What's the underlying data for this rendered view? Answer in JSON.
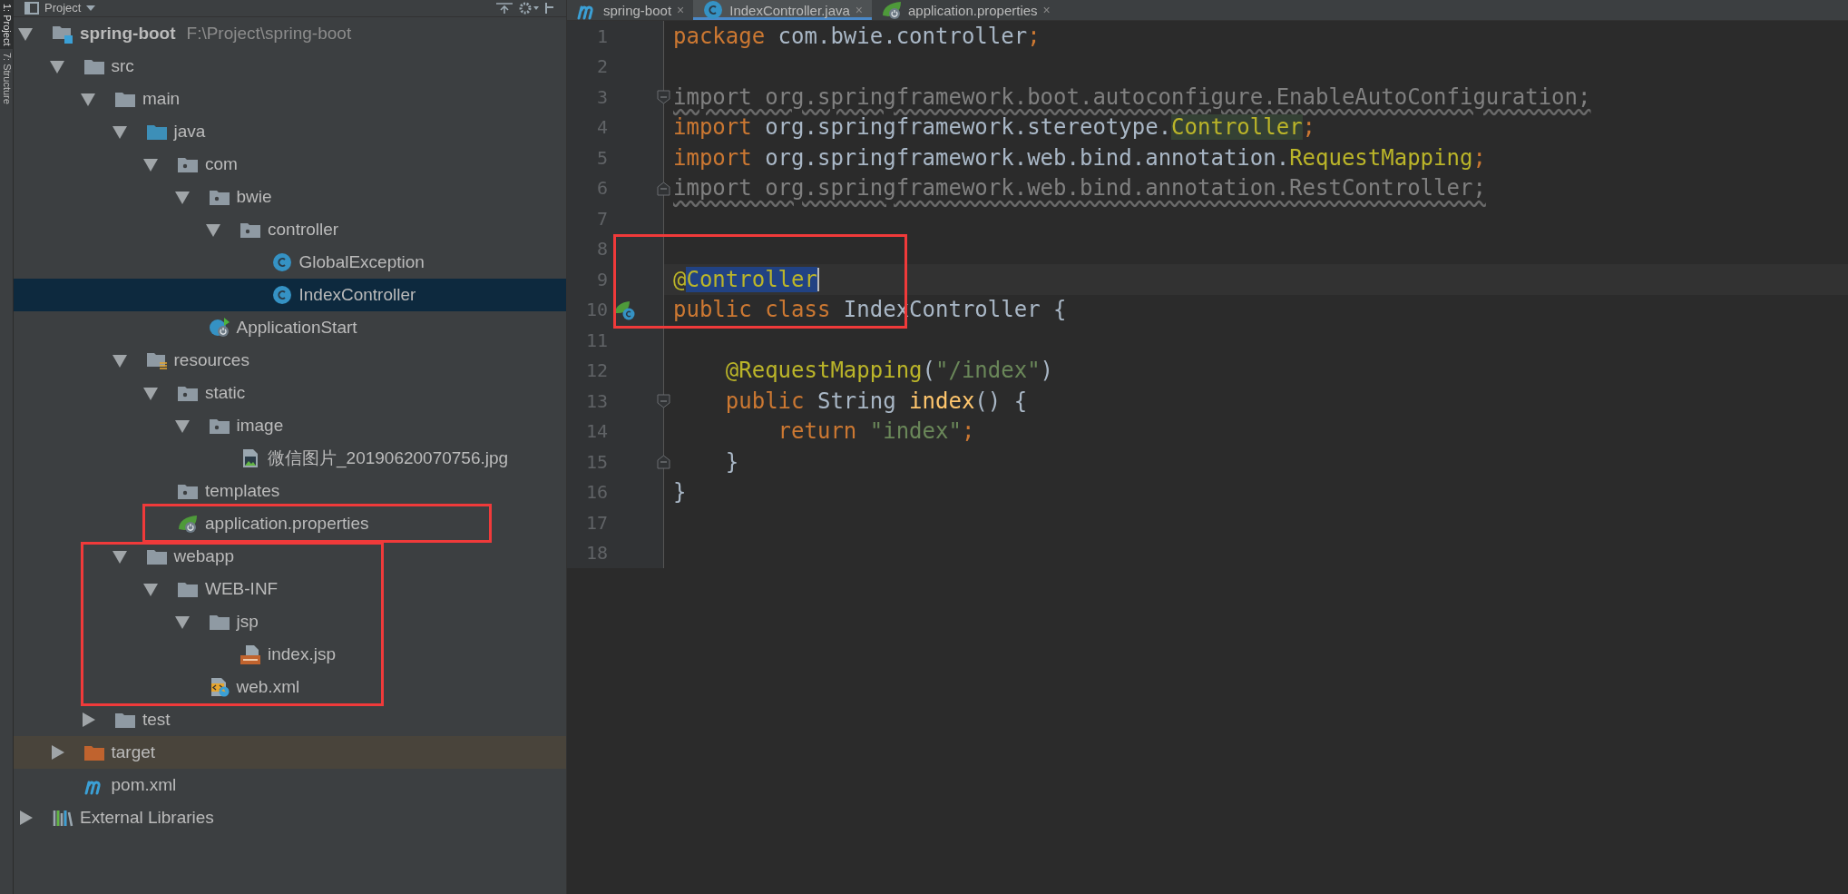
{
  "tool_strip": {
    "tabs": [
      {
        "label": "1: Project",
        "selected": true
      },
      {
        "label": "7: Structure",
        "selected": false
      }
    ]
  },
  "project_panel": {
    "title": "Project",
    "tree": [
      {
        "label": "spring-boot",
        "hint": "F:\\Project\\spring-boot",
        "kind": "module",
        "expanded": true,
        "selected": false,
        "outlined": false,
        "children": [
          {
            "label": "src",
            "kind": "folder",
            "expanded": true,
            "selected": false,
            "outlined": false,
            "children": [
              {
                "label": "main",
                "kind": "folder",
                "expanded": true,
                "selected": false,
                "outlined": false,
                "children": [
                  {
                    "label": "java",
                    "kind": "source",
                    "expanded": true,
                    "selected": false,
                    "outlined": false,
                    "children": [
                      {
                        "label": "com",
                        "kind": "package",
                        "expanded": true,
                        "selected": false,
                        "outlined": false,
                        "children": [
                          {
                            "label": "bwie",
                            "kind": "package",
                            "expanded": true,
                            "selected": false,
                            "outlined": false,
                            "children": [
                              {
                                "label": "controller",
                                "kind": "package",
                                "expanded": true,
                                "selected": false,
                                "outlined": false,
                                "children": [
                                  {
                                    "label": "GlobalException",
                                    "kind": "class",
                                    "selected": false,
                                    "outlined": false
                                  },
                                  {
                                    "label": "IndexController",
                                    "kind": "class",
                                    "selected": true,
                                    "outlined": false
                                  }
                                ]
                              }
                            ]
                          },
                          {
                            "label": "ApplicationStart",
                            "kind": "application",
                            "selected": false,
                            "outlined": false
                          }
                        ]
                      }
                    ]
                  },
                  {
                    "label": "resources",
                    "kind": "resources",
                    "expanded": true,
                    "selected": false,
                    "outlined": false,
                    "children": [
                      {
                        "label": "static",
                        "kind": "package",
                        "expanded": true,
                        "selected": false,
                        "outlined": false,
                        "children": [
                          {
                            "label": "image",
                            "kind": "package",
                            "expanded": true,
                            "selected": false,
                            "outlined": false,
                            "children": [
                              {
                                "label": "微信图片_20190620070756.jpg",
                                "kind": "image",
                                "selected": false,
                                "outlined": false
                              }
                            ]
                          }
                        ]
                      },
                      {
                        "label": "templates",
                        "kind": "package",
                        "selected": false,
                        "outlined": false
                      },
                      {
                        "label": "application.properties",
                        "kind": "properties",
                        "selected": false,
                        "outlined": true
                      }
                    ]
                  },
                  {
                    "label": "webapp",
                    "kind": "folder",
                    "expanded": true,
                    "selected": false,
                    "outlined": true,
                    "children": [
                      {
                        "label": "WEB-INF",
                        "kind": "folder",
                        "expanded": true,
                        "selected": false,
                        "outlined": false,
                        "children": [
                          {
                            "label": "jsp",
                            "kind": "folder",
                            "expanded": true,
                            "selected": false,
                            "outlined": false,
                            "children": [
                              {
                                "label": "index.jsp",
                                "kind": "jsp",
                                "selected": false,
                                "outlined": false
                              }
                            ]
                          },
                          {
                            "label": "web.xml",
                            "kind": "xml",
                            "selected": false,
                            "outlined": false
                          }
                        ]
                      }
                    ]
                  }
                ]
              },
              {
                "label": "test",
                "kind": "folder",
                "expanded": false,
                "selected": false,
                "outlined": false
              }
            ]
          },
          {
            "label": "target",
            "kind": "excluded",
            "expanded": false,
            "selected": false,
            "outlined": false
          },
          {
            "label": "pom.xml",
            "kind": "maven",
            "selected": false,
            "outlined": false
          }
        ]
      },
      {
        "label": "External Libraries",
        "kind": "libraries",
        "expanded": false,
        "selected": false,
        "outlined": false
      }
    ]
  },
  "editor": {
    "tabs": [
      {
        "label": "spring-boot",
        "kind": "maven",
        "selected": false,
        "close": "×"
      },
      {
        "label": "IndexController.java",
        "kind": "class",
        "selected": true,
        "close": "×"
      },
      {
        "label": "application.properties",
        "kind": "properties",
        "selected": false,
        "close": "×"
      }
    ],
    "lines": [
      {
        "number": "1",
        "current": false,
        "outlined": false,
        "tokens": [
          {
            "text": "package ",
            "kind": "keyword"
          },
          {
            "text": "com.bwie.controller",
            "kind": "plain"
          },
          {
            "text": ";",
            "kind": "keyword"
          }
        ]
      },
      {
        "number": "2",
        "current": false,
        "outlined": false
      },
      {
        "number": "3",
        "current": false,
        "outlined": false,
        "gutter": {
          "kind": "fold-open"
        },
        "tokens": [
          {
            "text": "import org.springframework.boot.autoconfigure.EnableAutoConfiguration;",
            "kind": "unused"
          }
        ]
      },
      {
        "number": "4",
        "current": false,
        "outlined": false,
        "tokens": [
          {
            "text": "import ",
            "kind": "keyword"
          },
          {
            "text": "org.springframework.stereotype.",
            "kind": "plain"
          },
          {
            "text": "Controller",
            "kind": "usage"
          },
          {
            "text": ";",
            "kind": "keyword"
          }
        ]
      },
      {
        "number": "5",
        "current": false,
        "outlined": false,
        "tokens": [
          {
            "text": "import ",
            "kind": "keyword"
          },
          {
            "text": "org.springframework.web.bind.annotation.",
            "kind": "plain"
          },
          {
            "text": "RequestMapping",
            "kind": "annotation"
          },
          {
            "text": ";",
            "kind": "keyword"
          }
        ]
      },
      {
        "number": "6",
        "current": false,
        "outlined": false,
        "gutter": {
          "kind": "fold-close"
        },
        "tokens": [
          {
            "text": "import org.springframework.web.bind.annotation.RestController;",
            "kind": "unused"
          }
        ]
      },
      {
        "number": "7",
        "current": false,
        "outlined": false
      },
      {
        "number": "8",
        "current": false,
        "outlined": true
      },
      {
        "number": "9",
        "current": true,
        "outlined": true,
        "tokens": [
          {
            "text": "@",
            "kind": "annotation"
          },
          {
            "text": "Controller",
            "kind": "selection"
          }
        ]
      },
      {
        "number": "10",
        "current": false,
        "outlined": true,
        "gutter": {
          "kind": "spring-bean"
        },
        "tokens": [
          {
            "text": "public class ",
            "kind": "keyword"
          },
          {
            "text": "IndexController {",
            "kind": "plain"
          }
        ]
      },
      {
        "number": "11",
        "current": false,
        "outlined": false
      },
      {
        "number": "12",
        "current": false,
        "outlined": false,
        "tokens": [
          {
            "text": "    @RequestMapping",
            "kind": "annotation"
          },
          {
            "text": "(",
            "kind": "plain"
          },
          {
            "text": "\"/index\"",
            "kind": "string"
          },
          {
            "text": ")",
            "kind": "plain"
          }
        ]
      },
      {
        "number": "13",
        "current": false,
        "outlined": false,
        "gutter": {
          "kind": "fold-open"
        },
        "tokens": [
          {
            "text": "    public ",
            "kind": "keyword"
          },
          {
            "text": "String ",
            "kind": "plain"
          },
          {
            "text": "index",
            "kind": "method"
          },
          {
            "text": "() {",
            "kind": "plain"
          }
        ]
      },
      {
        "number": "14",
        "current": false,
        "outlined": false,
        "tokens": [
          {
            "text": "        return ",
            "kind": "keyword"
          },
          {
            "text": "\"index\"",
            "kind": "string"
          },
          {
            "text": ";",
            "kind": "keyword"
          }
        ]
      },
      {
        "number": "15",
        "current": false,
        "outlined": false,
        "gutter": {
          "kind": "fold-close"
        },
        "tokens": [
          {
            "text": "    }",
            "kind": "plain"
          }
        ]
      },
      {
        "number": "16",
        "current": false,
        "outlined": false,
        "tokens": [
          {
            "text": "}",
            "kind": "plain"
          }
        ]
      },
      {
        "number": "17",
        "current": false,
        "outlined": false
      },
      {
        "number": "18",
        "current": false,
        "outlined": false
      }
    ]
  }
}
